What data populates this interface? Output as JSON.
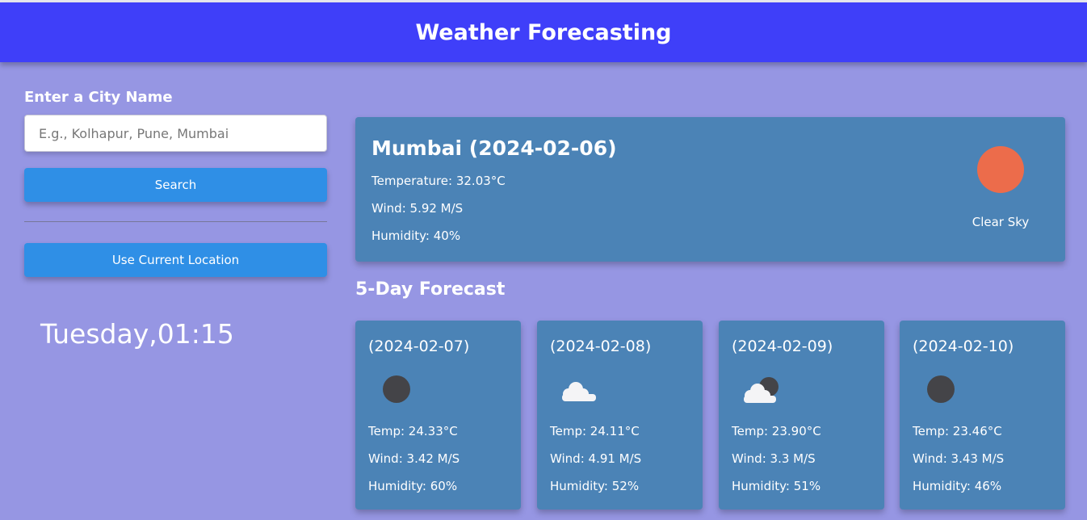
{
  "header": {
    "title": "Weather Forecasting"
  },
  "sidebar": {
    "city_label": "Enter a City Name",
    "search_placeholder": "E.g., Kolhapur, Pune, Mumbai",
    "search_value": "",
    "search_button": "Search",
    "location_button": "Use Current Location",
    "clock": "Tuesday,01:15"
  },
  "current": {
    "title": "Mumbai (2024-02-06)",
    "temperature": "Temperature: 32.03°C",
    "wind": "Wind: 5.92 M/S",
    "humidity": "Humidity: 40%",
    "condition": "Clear Sky",
    "icon": "sun-icon"
  },
  "forecast": {
    "title": "5-Day Forecast",
    "days": [
      {
        "date": "(2024-02-07)",
        "temp": "Temp: 24.33°C",
        "wind": "Wind: 3.42 M/S",
        "humidity": "Humidity: 60%",
        "icon": "moon-icon"
      },
      {
        "date": "(2024-02-08)",
        "temp": "Temp: 24.11°C",
        "wind": "Wind: 4.91 M/S",
        "humidity": "Humidity: 52%",
        "icon": "cloud-icon"
      },
      {
        "date": "(2024-02-09)",
        "temp": "Temp: 23.90°C",
        "wind": "Wind: 3.3 M/S",
        "humidity": "Humidity: 51%",
        "icon": "cloud-moon-icon"
      },
      {
        "date": "(2024-02-10)",
        "temp": "Temp: 23.46°C",
        "wind": "Wind: 3.43 M/S",
        "humidity": "Humidity: 46%",
        "icon": "moon-icon"
      }
    ]
  },
  "colors": {
    "background": "#9696e3",
    "header": "#3f3ff9",
    "button": "#2f8fe6",
    "card": "#4b83b6",
    "sun": "#ec6c4b"
  }
}
